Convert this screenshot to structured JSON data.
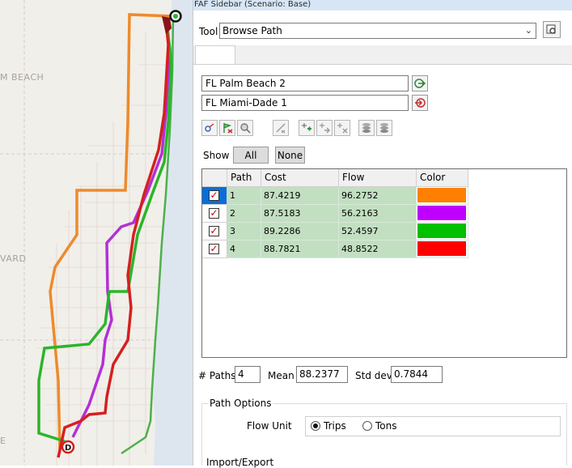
{
  "map": {
    "labels": [
      "M BEACH",
      "VARD",
      "E"
    ],
    "route_colors": [
      "#ee8a2a",
      "#b130d8",
      "#2ab52a",
      "#d42020"
    ]
  },
  "sidebar": {
    "title": "FAF Sidebar (Scenario: Base)",
    "tool_label": "Tool",
    "tool_value": "Browse Path",
    "origin": "FL Palm Beach 2",
    "destination": "FL Miami-Dade 1",
    "toolbar_icons": [
      "path-select-icon",
      "clear-flag-icon",
      "zoom-icon",
      "swap-icon",
      "add-node-icon",
      "add-arrow-icon",
      "remove-node-icon",
      "layers-icon",
      "layers-alt-icon"
    ],
    "show_label": "Show",
    "show_all": "All",
    "show_none": "None",
    "grid": {
      "headers": [
        "Path",
        "Cost",
        "Flow",
        "Color"
      ],
      "rows": [
        {
          "path": "1",
          "cost": "87.4219",
          "flow": "96.2752",
          "color": "#ff8000",
          "checked": true
        },
        {
          "path": "2",
          "cost": "87.5183",
          "flow": "56.2163",
          "color": "#c000ff",
          "checked": true
        },
        {
          "path": "3",
          "cost": "89.2286",
          "flow": "52.4597",
          "color": "#00c000",
          "checked": true
        },
        {
          "path": "4",
          "cost": "88.7821",
          "flow": "48.8522",
          "color": "#ff0000",
          "checked": true
        }
      ]
    },
    "stats": {
      "paths_label": "# Paths",
      "paths_value": "4",
      "mean_label": "Mean",
      "mean_value": "88.2377",
      "std_label": "Std dev",
      "std_value": "0.7844"
    },
    "path_options": {
      "title": "Path Options",
      "flow_unit_label": "Flow Unit",
      "trips_label": "Trips",
      "tons_label": "Tons",
      "selected": "Trips"
    },
    "import_export_label": "Import/Export"
  }
}
